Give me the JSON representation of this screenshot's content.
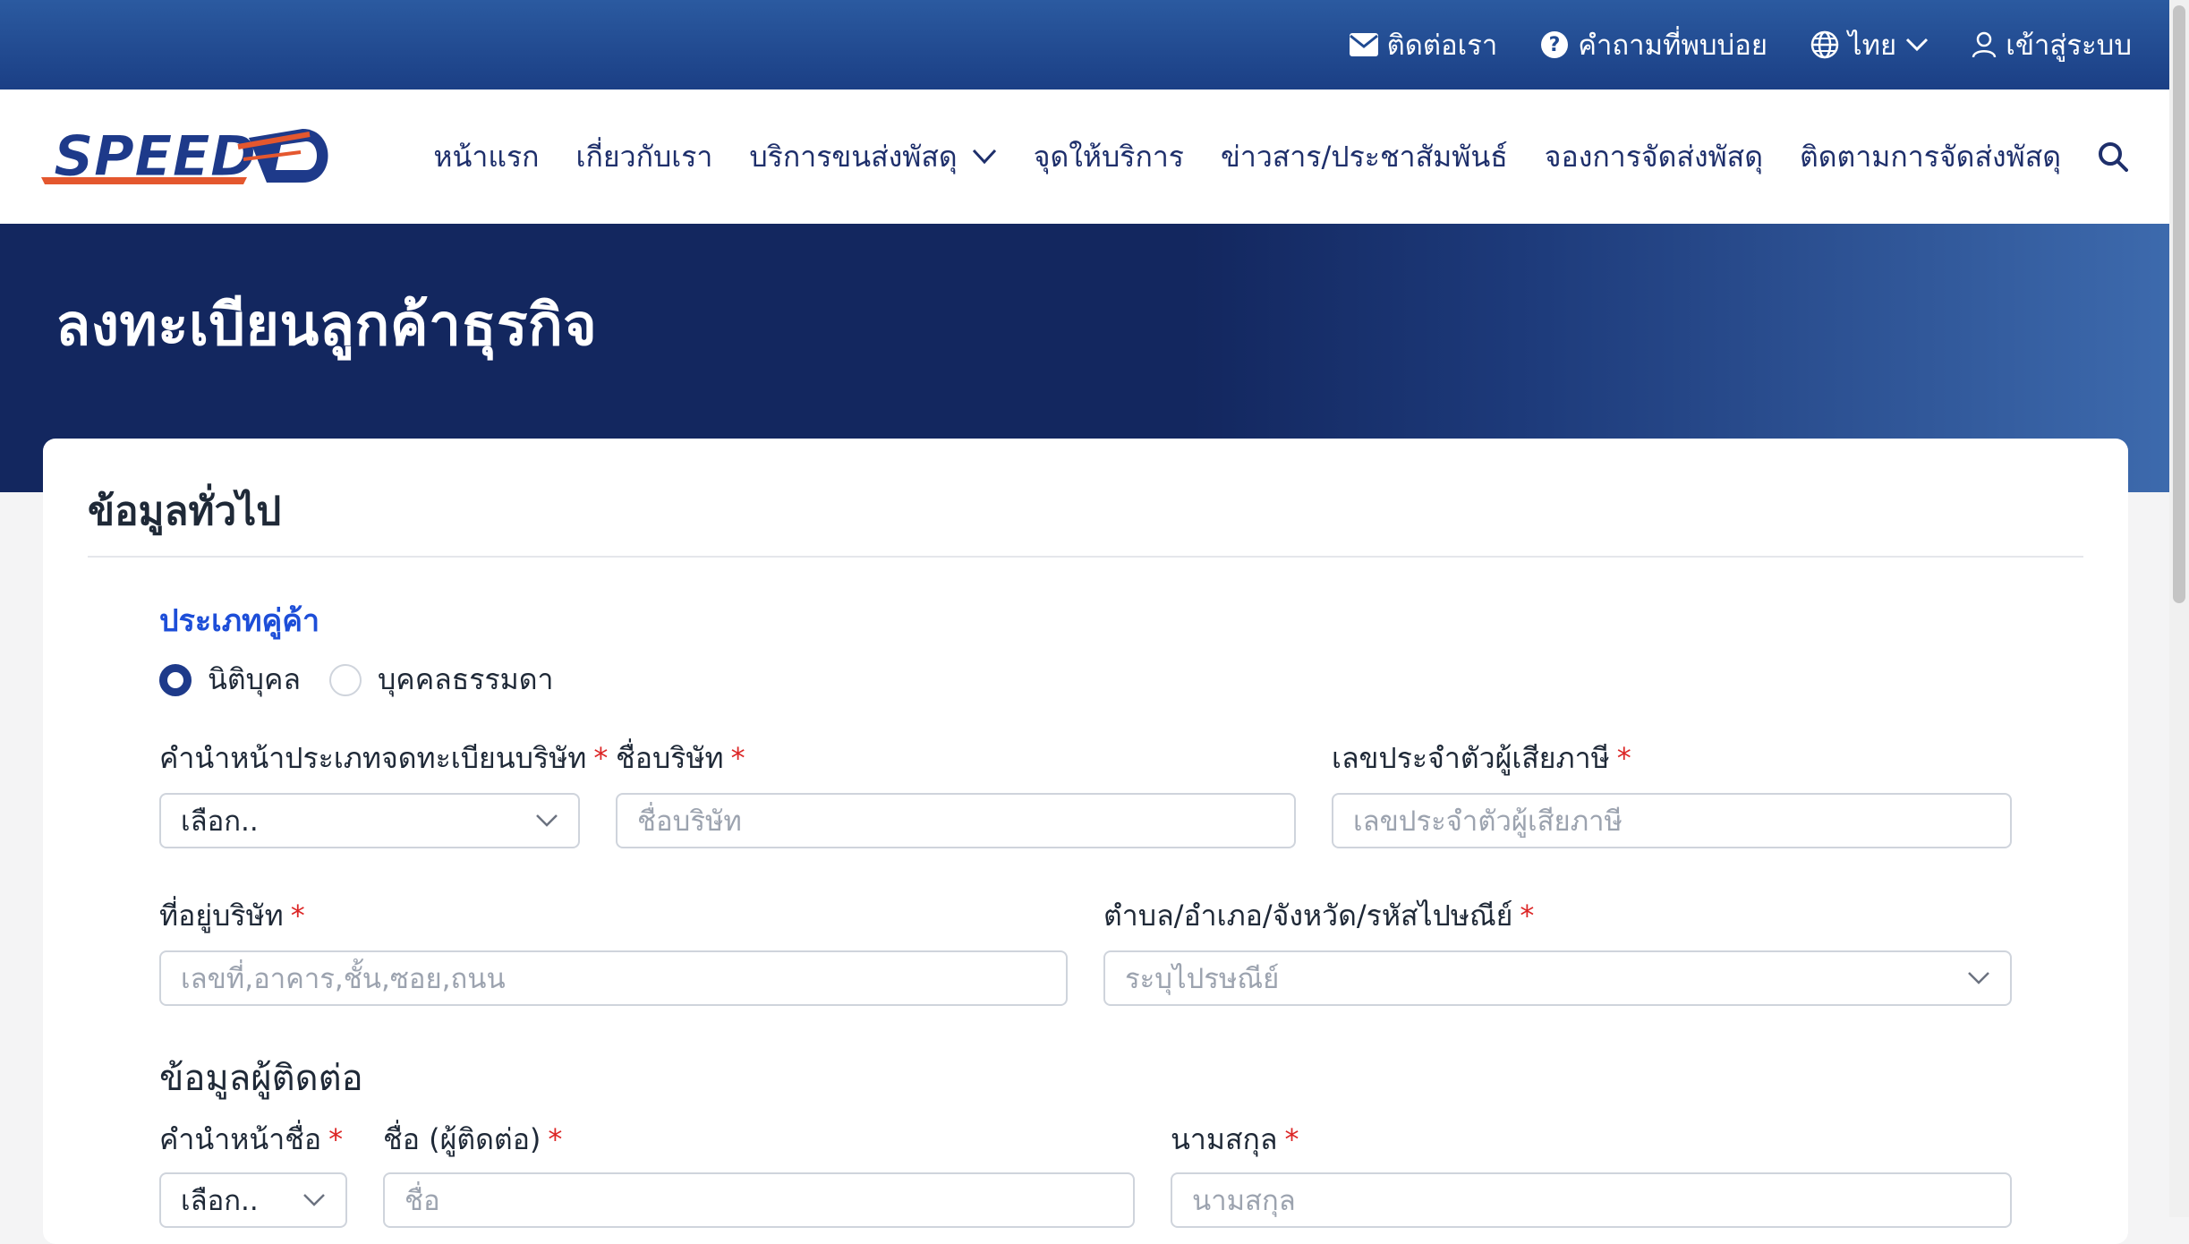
{
  "topbar": {
    "contact": "ติดต่อเรา",
    "faq": "คำถามที่พบบ่อย",
    "language": "ไทย",
    "login": "เข้าสู่ระบบ"
  },
  "logo": {
    "text": "SPEED",
    "mark": "D"
  },
  "nav": {
    "items": [
      {
        "label": "หน้าแรก"
      },
      {
        "label": "เกี่ยวกับเรา"
      },
      {
        "label": "บริการขนส่งพัสดุ"
      },
      {
        "label": "จุดให้บริการ"
      },
      {
        "label": "ข่าวสาร/ประชาสัมพันธ์"
      },
      {
        "label": "จองการจัดส่งพัสดุ"
      },
      {
        "label": "ติดตามการจัดส่งพัสดุ"
      }
    ]
  },
  "hero": {
    "title": "ลงทะเบียนลูกค้าธุรกิจ"
  },
  "form": {
    "title": "ข้อมูลทั่วไป",
    "partner_type": {
      "label": "ประเภทคู่ค้า",
      "options": [
        "นิติบุคล",
        "บุคคลธรรมดา"
      ],
      "selected": "นิติบุคล"
    },
    "company_prefix": {
      "label": "คำนำหน้าประเภทจดทะเบียนบริษัท",
      "value": "เลือก.."
    },
    "company_name": {
      "label": "ชื่อบริษัท",
      "placeholder": "ชื่อบริษัท"
    },
    "tax_id": {
      "label": "เลขประจำตัวผู้เสียภาษี",
      "placeholder": "เลขประจำตัวผู้เสียภาษี"
    },
    "address": {
      "label": "ที่อยู่บริษัท",
      "placeholder": "เลขที่,อาคาร,ชั้น,ซอย,ถนน"
    },
    "district": {
      "label": "ตำบล/อำเภอ/จังหวัด/รหัสไปษณีย์",
      "placeholder": "ระบุไปรษณีย์"
    },
    "contact_section": "ข้อมูลผู้ติดต่อ",
    "contact_prefix": {
      "label": "คำนำหน้าชื่อ",
      "value": "เลือก.."
    },
    "contact_first": {
      "label": "ชื่อ (ผู้ติดต่อ)",
      "placeholder": "ชื่อ"
    },
    "contact_last": {
      "label": "นามสกุล",
      "placeholder": "นามสกุล"
    },
    "required_mark": "*"
  },
  "colors": {
    "brand_navy": "#13275f",
    "accent_blue": "#1d4ed8",
    "required_red": "#dc2626"
  }
}
